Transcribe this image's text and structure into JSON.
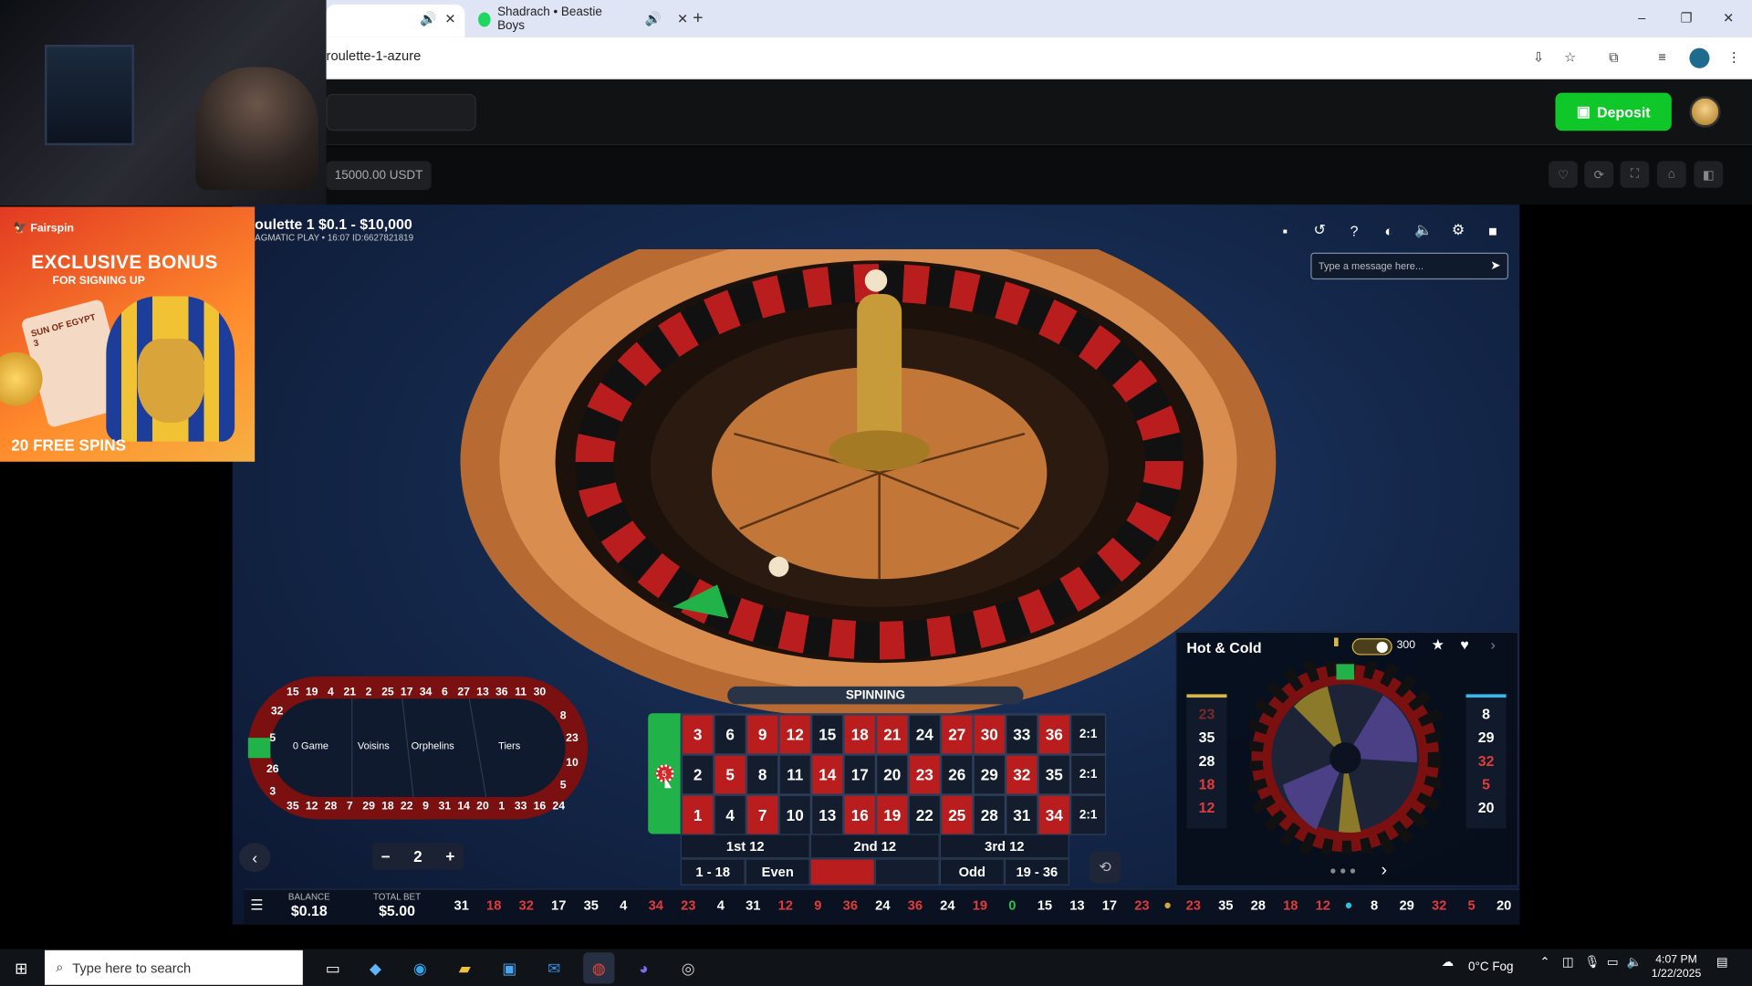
{
  "browser": {
    "tabs": [
      {
        "label": "Shadrach • Beastie Boys"
      }
    ],
    "url": "roulette-1-azure",
    "window_controls": {
      "minimize": "–",
      "restore": "❐",
      "close": "✕"
    }
  },
  "site": {
    "deposit_label": "Deposit",
    "balance_pill": "15000.00 USDT"
  },
  "ad": {
    "brand": "Fairspin",
    "headline": "EXCLUSIVE BONUS",
    "subhead": "FOR SIGNING UP",
    "card_text": "SUN OF EGYPT 3",
    "spins": "20 FREE SPINS"
  },
  "game": {
    "title": "oulette 1 $0.1 - $10,000",
    "subtitle": "AGMATIC PLAY • 16:07 ID:6627821819",
    "chat_placeholder": "Type a message here...",
    "status": "SPINNING",
    "racetrack": {
      "top": [
        "15",
        "19",
        "4",
        "21",
        "2",
        "25",
        "17",
        "34",
        "6",
        "27",
        "13",
        "36",
        "11",
        "30"
      ],
      "bottom": [
        "35",
        "12",
        "28",
        "7",
        "29",
        "18",
        "22",
        "9",
        "31",
        "14",
        "20",
        "1",
        "33",
        "16",
        "24"
      ],
      "left": [
        "32",
        "5",
        "26",
        "3"
      ],
      "right": [
        "8",
        "23",
        "10",
        "5"
      ],
      "sections": [
        "0 Game",
        "Voisins",
        "Orphelins",
        "Tiers"
      ]
    },
    "grid": {
      "zero_chip": "5",
      "rows": [
        [
          {
            "n": "3",
            "c": "r"
          },
          {
            "n": "6",
            "c": "b"
          },
          {
            "n": "9",
            "c": "r"
          },
          {
            "n": "12",
            "c": "r"
          },
          {
            "n": "15",
            "c": "b"
          },
          {
            "n": "18",
            "c": "r"
          },
          {
            "n": "21",
            "c": "r"
          },
          {
            "n": "24",
            "c": "b"
          },
          {
            "n": "27",
            "c": "r"
          },
          {
            "n": "30",
            "c": "r"
          },
          {
            "n": "33",
            "c": "b"
          },
          {
            "n": "36",
            "c": "r"
          },
          {
            "n": "2:1",
            "c": "c"
          }
        ],
        [
          {
            "n": "2",
            "c": "b"
          },
          {
            "n": "5",
            "c": "r"
          },
          {
            "n": "8",
            "c": "b"
          },
          {
            "n": "11",
            "c": "b"
          },
          {
            "n": "14",
            "c": "r"
          },
          {
            "n": "17",
            "c": "b"
          },
          {
            "n": "20",
            "c": "b"
          },
          {
            "n": "23",
            "c": "r"
          },
          {
            "n": "26",
            "c": "b"
          },
          {
            "n": "29",
            "c": "b"
          },
          {
            "n": "32",
            "c": "r"
          },
          {
            "n": "35",
            "c": "b"
          },
          {
            "n": "2:1",
            "c": "c"
          }
        ],
        [
          {
            "n": "1",
            "c": "r"
          },
          {
            "n": "4",
            "c": "b"
          },
          {
            "n": "7",
            "c": "r"
          },
          {
            "n": "10",
            "c": "b"
          },
          {
            "n": "13",
            "c": "b"
          },
          {
            "n": "16",
            "c": "r"
          },
          {
            "n": "19",
            "c": "r"
          },
          {
            "n": "22",
            "c": "b"
          },
          {
            "n": "25",
            "c": "r"
          },
          {
            "n": "28",
            "c": "b"
          },
          {
            "n": "31",
            "c": "b"
          },
          {
            "n": "34",
            "c": "r"
          },
          {
            "n": "2:1",
            "c": "c"
          }
        ]
      ],
      "dozens": [
        "1st 12",
        "2nd 12",
        "3rd 12"
      ],
      "outside": [
        "1 - 18",
        "Even",
        "",
        "",
        "Odd",
        "19 - 36"
      ]
    },
    "hot_cold": {
      "title": "Hot & Cold",
      "count": "300",
      "hot": [
        {
          "n": "23",
          "c": "dimred"
        },
        {
          "n": "35",
          "c": "w"
        },
        {
          "n": "28",
          "c": "w"
        },
        {
          "n": "18",
          "c": "red"
        },
        {
          "n": "12",
          "c": "red"
        }
      ],
      "cold": [
        {
          "n": "8",
          "c": "w"
        },
        {
          "n": "29",
          "c": "w"
        },
        {
          "n": "32",
          "c": "red"
        },
        {
          "n": "5",
          "c": "red"
        },
        {
          "n": "20",
          "c": "w"
        }
      ]
    },
    "chip_value": "2",
    "balance_label": "BALANCE",
    "balance_value": "$0.18",
    "total_bet_label": "TOTAL BET",
    "total_bet_value": "$5.00",
    "history": [
      {
        "n": "31",
        "c": "black"
      },
      {
        "n": "18",
        "c": "red"
      },
      {
        "n": "32",
        "c": "red"
      },
      {
        "n": "17",
        "c": "black"
      },
      {
        "n": "35",
        "c": "black"
      },
      {
        "n": "4",
        "c": "black"
      },
      {
        "n": "34",
        "c": "red"
      },
      {
        "n": "23",
        "c": "red"
      },
      {
        "n": "4",
        "c": "black"
      },
      {
        "n": "31",
        "c": "black"
      },
      {
        "n": "12",
        "c": "red"
      },
      {
        "n": "9",
        "c": "red"
      },
      {
        "n": "36",
        "c": "red"
      },
      {
        "n": "24",
        "c": "black"
      },
      {
        "n": "36",
        "c": "red"
      },
      {
        "n": "24",
        "c": "black"
      },
      {
        "n": "19",
        "c": "red"
      },
      {
        "n": "0",
        "c": "green"
      },
      {
        "n": "15",
        "c": "black"
      },
      {
        "n": "13",
        "c": "black"
      },
      {
        "n": "17",
        "c": "black"
      },
      {
        "n": "23",
        "c": "red"
      },
      {
        "n": "•",
        "c": "dot-gold"
      },
      {
        "n": "23",
        "c": "red"
      },
      {
        "n": "35",
        "c": "black"
      },
      {
        "n": "28",
        "c": "black"
      },
      {
        "n": "18",
        "c": "red"
      },
      {
        "n": "12",
        "c": "red"
      },
      {
        "n": "•",
        "c": "dot-teal"
      },
      {
        "n": "8",
        "c": "black"
      },
      {
        "n": "29",
        "c": "black"
      },
      {
        "n": "32",
        "c": "red"
      },
      {
        "n": "5",
        "c": "red"
      },
      {
        "n": "20",
        "c": "black"
      }
    ]
  },
  "taskbar": {
    "search_placeholder": "Type here to search",
    "weather": "0°C  Fog",
    "time": "4:07 PM",
    "date": "1/22/2025"
  },
  "colors": {
    "deposit": "#10c72a",
    "red": "#b91d1d",
    "green": "#21b24a",
    "table": "#141d2e"
  }
}
